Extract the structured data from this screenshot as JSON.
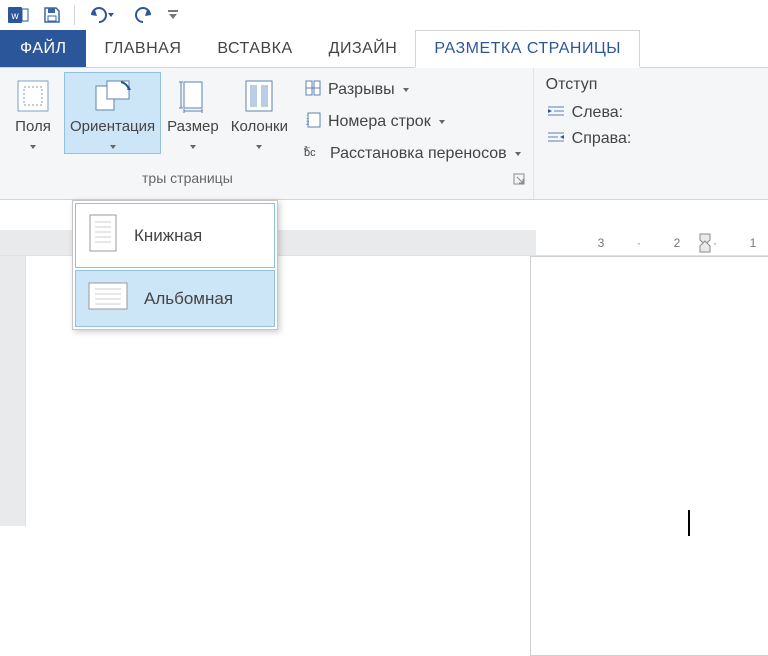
{
  "qat": {
    "undo_label": "Отменить",
    "redo_label": "Повторить"
  },
  "tabs": {
    "file": "ФАЙЛ",
    "home": "ГЛАВНАЯ",
    "insert": "ВСТАВКА",
    "design": "ДИЗАЙН",
    "page_layout": "РАЗМЕТКА СТРАНИЦЫ"
  },
  "ribbon": {
    "margins": "Поля",
    "orientation": "Ориентация",
    "size": "Размер",
    "columns": "Колонки",
    "breaks": "Разрывы",
    "line_numbers": "Номера строк",
    "hyphenation": "Расстановка переносов",
    "page_setup_group_partial": "тры страницы",
    "indent_title": "Отступ",
    "indent_left": "Слева:",
    "indent_right": "Справа:"
  },
  "orientation_menu": {
    "portrait": "Книжная",
    "landscape": "Альбомная"
  },
  "ruler": {
    "n3": "3",
    "n2": "2",
    "n1": "1"
  }
}
